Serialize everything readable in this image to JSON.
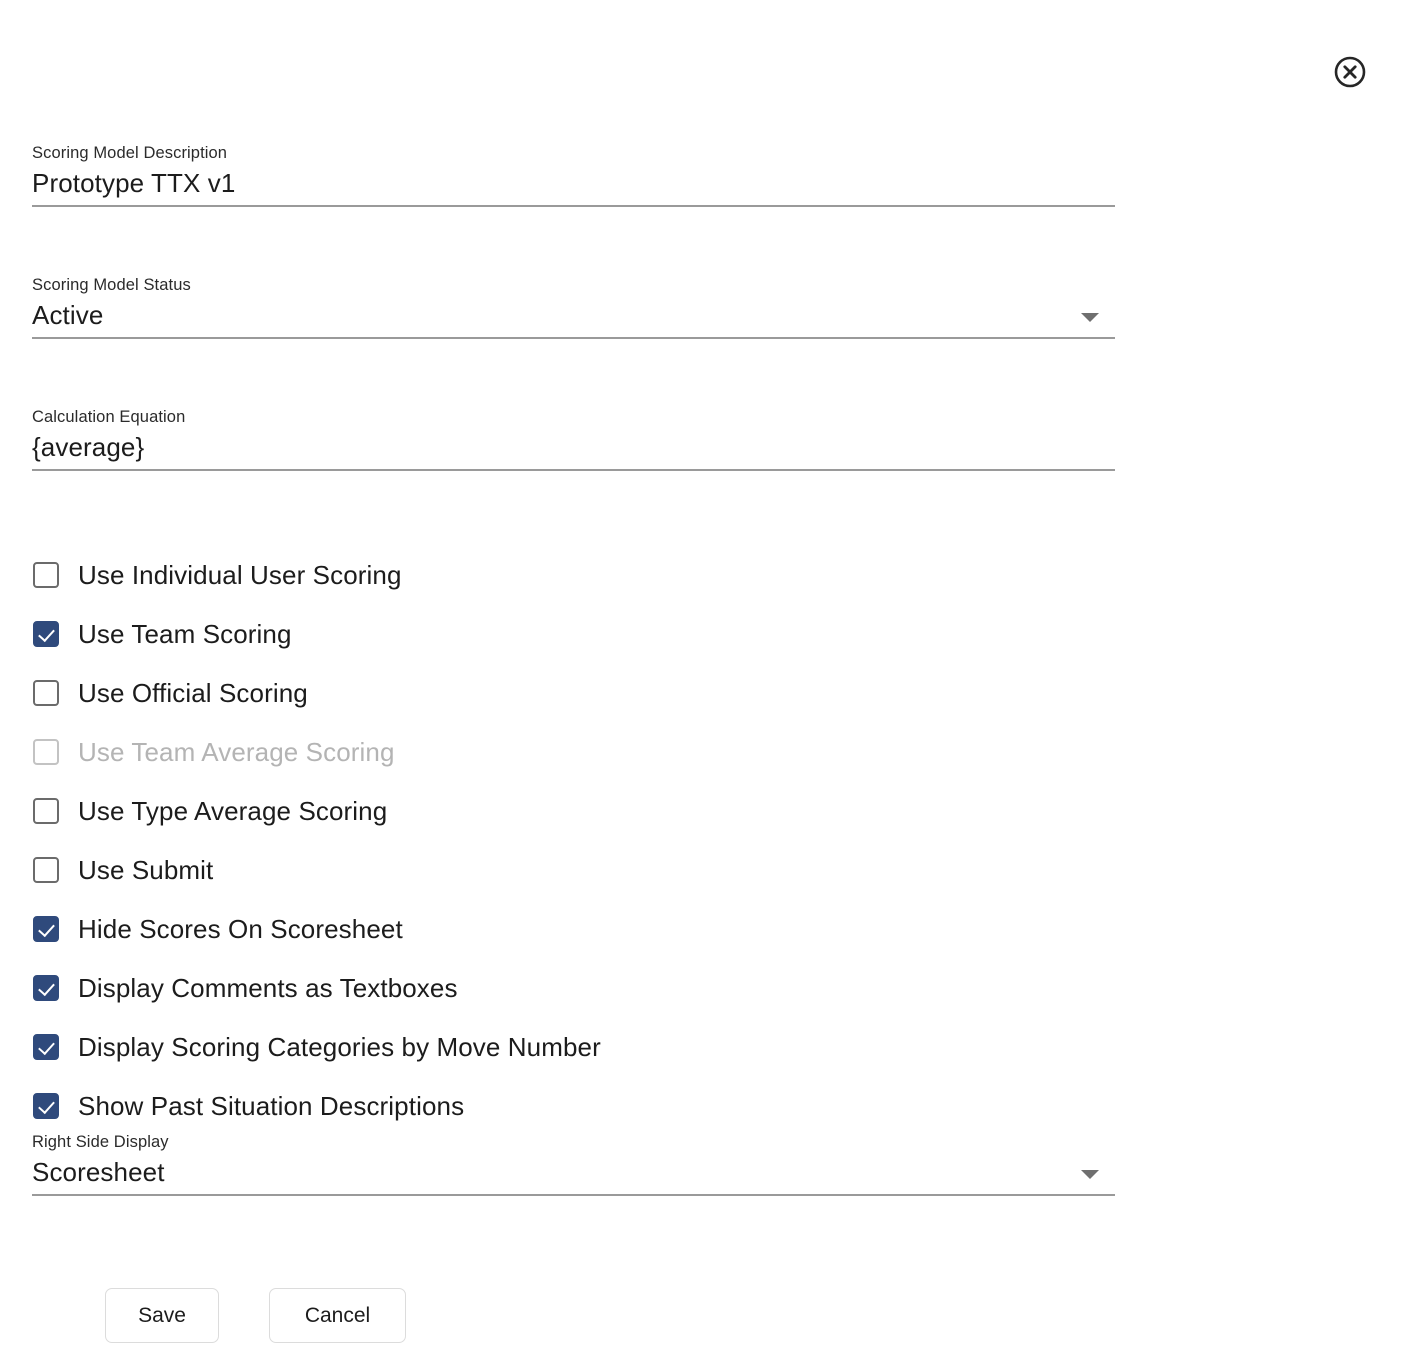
{
  "dialog": {
    "close_icon": "close-circle-icon"
  },
  "fields": [
    {
      "name": "scoring-model-description",
      "label": "Scoring Model Description",
      "value": "Prototype TTX v1",
      "type": "text",
      "placeholder": ""
    },
    {
      "name": "scoring-model-status",
      "label": "Scoring Model Status",
      "value": "Active",
      "type": "select",
      "caret_icon": "chevron-down-icon"
    },
    {
      "name": "calculation-equation",
      "label": "Calculation Equation",
      "value": "{average}",
      "type": "text",
      "placeholder": ""
    },
    {
      "name": "right-side-display",
      "label": "Right Side Display",
      "value": "Scoresheet",
      "type": "select",
      "caret_icon": "chevron-down-icon"
    }
  ],
  "checkboxes": [
    {
      "name": "use-individual-user-scoring",
      "label": "Use Individual User Scoring",
      "checked": false,
      "disabled": false
    },
    {
      "name": "use-team-scoring",
      "label": "Use Team Scoring",
      "checked": true,
      "disabled": false
    },
    {
      "name": "use-official-scoring",
      "label": "Use Official Scoring",
      "checked": false,
      "disabled": false
    },
    {
      "name": "use-team-average-scoring",
      "label": "Use Team Average Scoring",
      "checked": false,
      "disabled": true
    },
    {
      "name": "use-type-average-scoring",
      "label": "Use Type Average Scoring",
      "checked": false,
      "disabled": false
    },
    {
      "name": "use-submit",
      "label": "Use Submit",
      "checked": false,
      "disabled": false
    },
    {
      "name": "hide-scores-on-scoresheet",
      "label": "Hide Scores On Scoresheet",
      "checked": true,
      "disabled": false
    },
    {
      "name": "display-comments-as-textboxes",
      "label": "Display Comments as Textboxes",
      "checked": true,
      "disabled": false
    },
    {
      "name": "display-scoring-categories-by-move",
      "label": "Display Scoring Categories by Move Number",
      "checked": true,
      "disabled": false
    },
    {
      "name": "show-past-situation-descriptions",
      "label": "Show Past Situation Descriptions",
      "checked": true,
      "disabled": false
    }
  ],
  "actions": {
    "save_label": "Save",
    "cancel_label": "Cancel"
  },
  "colors": {
    "checkbox_checked": "#2f4a7c",
    "checkbox_border": "#6b6b6b",
    "field_underline": "#9a9a9a",
    "disabled_text": "#b4b4b4",
    "text": "#1c1c1c"
  }
}
